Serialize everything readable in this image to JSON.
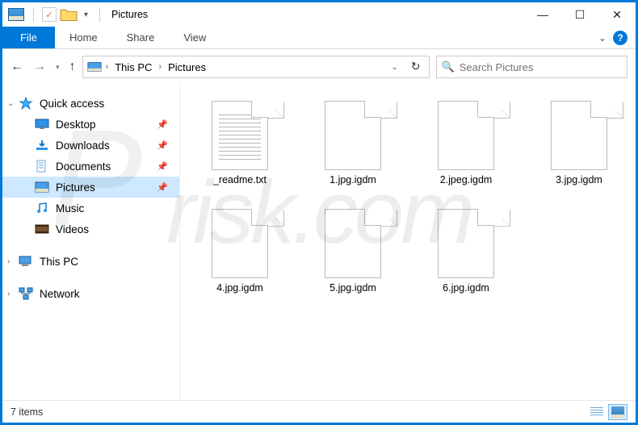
{
  "window": {
    "title": "Pictures"
  },
  "ribbon": {
    "file": "File",
    "tabs": [
      "Home",
      "Share",
      "View"
    ]
  },
  "breadcrumb": {
    "root": "This PC",
    "current": "Pictures"
  },
  "search": {
    "placeholder": "Search Pictures"
  },
  "sidebar": {
    "quick": "Quick access",
    "items": [
      {
        "label": "Desktop",
        "pinned": true,
        "icon": "desktop"
      },
      {
        "label": "Downloads",
        "pinned": true,
        "icon": "downloads"
      },
      {
        "label": "Documents",
        "pinned": true,
        "icon": "documents"
      },
      {
        "label": "Pictures",
        "pinned": true,
        "icon": "pictures",
        "selected": true
      },
      {
        "label": "Music",
        "pinned": false,
        "icon": "music"
      },
      {
        "label": "Videos",
        "pinned": false,
        "icon": "videos"
      }
    ],
    "thispc": "This PC",
    "network": "Network"
  },
  "files": [
    {
      "name": "_readme.txt",
      "type": "txt"
    },
    {
      "name": "1.jpg.igdm",
      "type": "blank"
    },
    {
      "name": "2.jpeg.igdm",
      "type": "blank"
    },
    {
      "name": "3.jpg.igdm",
      "type": "blank"
    },
    {
      "name": "4.jpg.igdm",
      "type": "blank"
    },
    {
      "name": "5.jpg.igdm",
      "type": "blank"
    },
    {
      "name": "6.jpg.igdm",
      "type": "blank"
    }
  ],
  "status": {
    "count": "7 items"
  },
  "watermark": {
    "a": "P",
    "b": "risk.com"
  }
}
